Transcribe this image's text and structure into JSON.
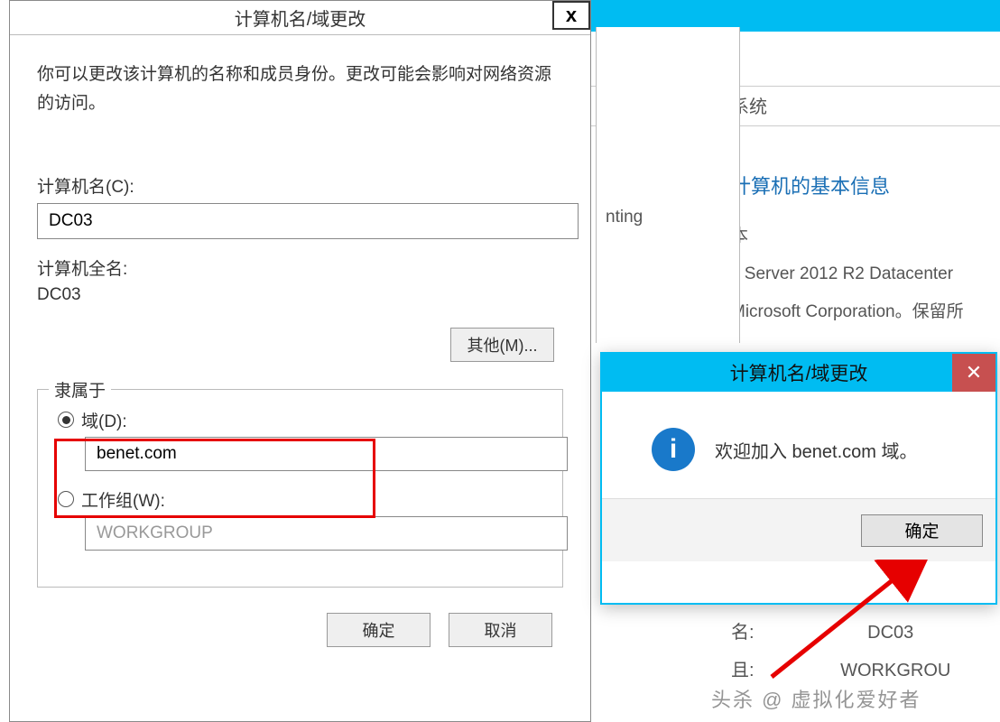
{
  "main_dialog": {
    "title": "计算机名/域更改",
    "description": "你可以更改该计算机的名称和成员身份。更改可能会影响对网络资源的访问。",
    "computer_name_label": "计算机名(C):",
    "computer_name_value": "DC03",
    "full_name_label": "计算机全名:",
    "full_name_value": "DC03",
    "other_button": "其他(M)...",
    "membership": {
      "legend": "隶属于",
      "domain_label": "域(D):",
      "domain_value": "benet.com",
      "domain_selected": true,
      "workgroup_label": "工作组(W):",
      "workgroup_value": "WORKGROUP",
      "workgroup_selected": false
    },
    "ok": "确定",
    "cancel": "取消"
  },
  "mid_fragment": {
    "text": "nting"
  },
  "bg_window": {
    "menubar_right": "系",
    "system_label": "系统",
    "info_heading": "计算机的基本信息",
    "edition_label": "本",
    "os": "s Server 2012 R2 Datacenter",
    "copyright": "Microsoft Corporation。保留所",
    "lower_name_label": "名:",
    "lower_name_value": "DC03",
    "lower_group_label": "且:",
    "lower_group_value": "WORKGROU"
  },
  "msgbox": {
    "title": "计算机名/域更改",
    "message": "欢迎加入 benet.com 域。",
    "ok": "确定"
  },
  "watermark": "头杀 @ 虚拟化爱好者"
}
